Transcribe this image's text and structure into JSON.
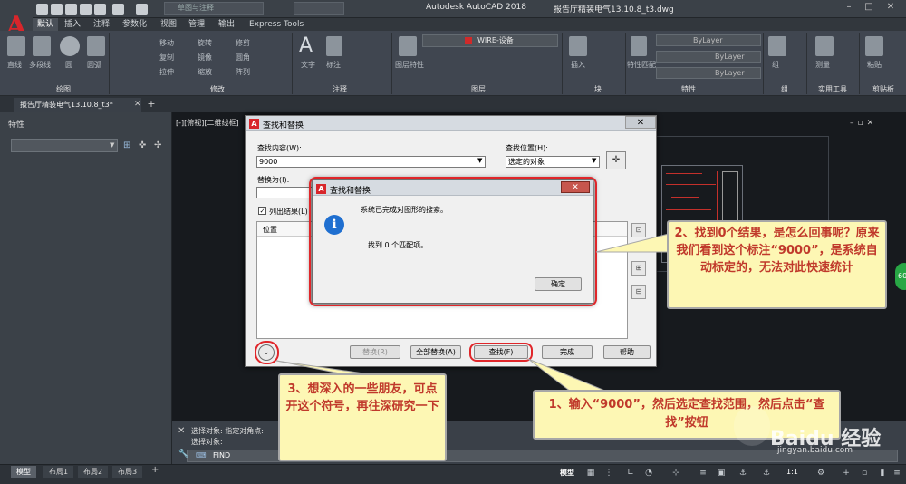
{
  "app": {
    "title": "Autodesk AutoCAD 2018",
    "filename": "报告厅精装电气13.10.8_t3.dwg",
    "workspace": "草图与注释",
    "logo": "A"
  },
  "ribbon_tabs": [
    "默认",
    "插入",
    "注释",
    "参数化",
    "视图",
    "管理",
    "输出",
    "Express Tools"
  ],
  "ribbon_panels": [
    "绘图",
    "修改",
    "注释",
    "图层",
    "块",
    "特性",
    "组",
    "实用工具",
    "剪贴板"
  ],
  "ribbon_labels": {
    "draw_line": "直线",
    "draw_polyline": "多段线",
    "draw_circle": "圆",
    "draw_arc": "圆弧",
    "text": "文字",
    "annotate": "标注",
    "layer_props": "图层特性",
    "layer_name": "WIRE-设备",
    "insert": "插入",
    "match": "特性匹配",
    "bylayer": "ByLayer",
    "group": "组",
    "measure": "测量",
    "paste": "粘贴",
    "move": "移动",
    "rotate": "旋转",
    "trim": "修剪",
    "copy": "复制",
    "mirror": "镜像",
    "fillet": "圆角",
    "stretch": "拉伸",
    "scale": "缩放",
    "array": "阵列"
  },
  "doc_tab": "报告厅精装电气13.10.8_t3*",
  "left_panel": {
    "title": "特性"
  },
  "viewport_label": "[-][俯视][二维线框]",
  "find_dialog": {
    "title": "查找和替换",
    "find_label": "查找内容(W):",
    "find_value": "9000",
    "where_label": "查找位置(H):",
    "where_value": "选定的对象",
    "replace_label": "替换为(I):",
    "list_results": "列出结果(L)",
    "column_location": "位置",
    "btn_replace": "替换(R)",
    "btn_replace_all": "全部替换(A)",
    "btn_find": "查找(F)",
    "btn_done": "完成",
    "btn_help": "帮助"
  },
  "msg_dialog": {
    "title": "查找和替换",
    "line1": "系统已完成对图形的搜索。",
    "line2": "找到 0 个匹配项。",
    "ok": "确定"
  },
  "command": {
    "history1": "选择对象: 指定对角点:",
    "history2": "选择对象:",
    "input": "FIND"
  },
  "layout_tabs": [
    "模型",
    "布局1",
    "布局2",
    "布局3"
  ],
  "status": {
    "model": "模型",
    "scale": "1:1"
  },
  "annotations": {
    "note1": "1、输入“9000”，然后选定查找范围，然后点击“查找”按钮",
    "note2": "2、找到0个结果，是怎么回事呢？原来我们看到这个标注“9000”，是系统自动标定的，无法对此快速统计",
    "note3": "3、想深入的一些朋友，可点开这个符号，再往深研究一下"
  },
  "watermark": {
    "text": "Baidu 经验",
    "url": "jingyan.baidu.com"
  },
  "badge": "60",
  "colors": {
    "accent_red": "#e0262a",
    "callout_bg": "#fdf7b4",
    "callout_text": "#c0392b"
  }
}
